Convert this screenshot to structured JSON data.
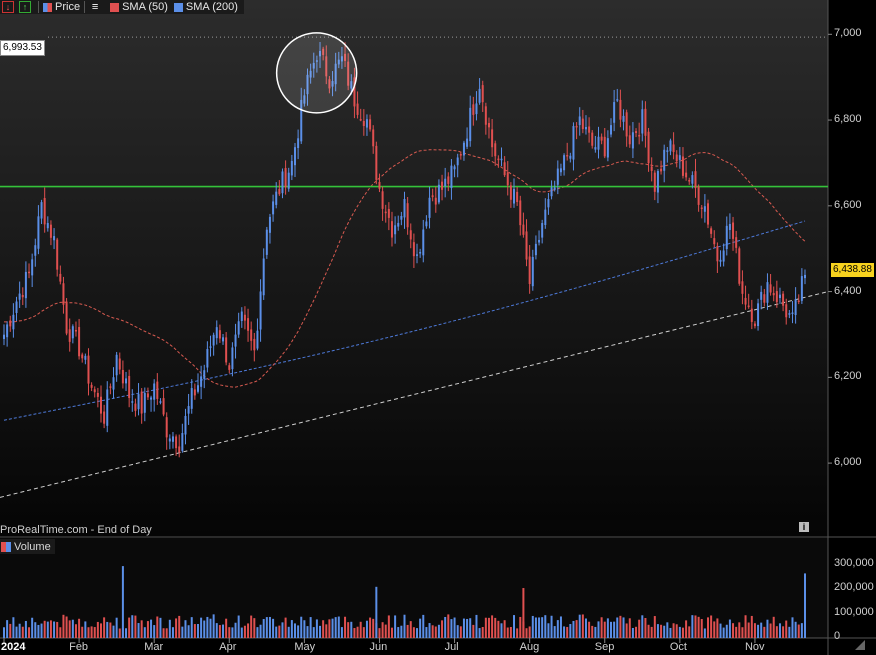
{
  "legend": {
    "price_label": "Price",
    "sma50_label": "SMA (50)",
    "sma200_label": "SMA (200)",
    "volume_label": "Volume"
  },
  "source_text": "ProRealTime.com - End of Day",
  "tags": {
    "period_high": "6,993.53",
    "last_price": "6,438.88"
  },
  "colors": {
    "up": "#5b8fe8",
    "down": "#e05050",
    "sma50": "#d85a50",
    "sma200": "#4d79d8",
    "resistance": "#34c23a",
    "trend": "#cfcfcf"
  },
  "chart_data": {
    "type": "candlestick",
    "instrument_note": "Daily candles with SMA(50), SMA(200), volume panel",
    "x_ticks": [
      "2024",
      "Feb",
      "Mar",
      "Apr",
      "May",
      "Jun",
      "Jul",
      "Aug",
      "Sep",
      "Oct",
      "Nov"
    ],
    "y_ticks": [
      "6,000",
      "6,200",
      "6,400",
      "6,600",
      "6,800",
      "7,000"
    ],
    "ylim": [
      5830,
      7080
    ],
    "volume_ticks": [
      "0",
      "100,000",
      "200,000",
      "300,000"
    ],
    "volume_lim": [
      0,
      320000
    ],
    "period_high": 6993.53,
    "last_close": 6438.88,
    "resistance_level": 6645,
    "trendline": {
      "start_value": 5920,
      "end_value": 6400
    },
    "anchors": [
      {
        "label": "2024",
        "close": 6300
      },
      {
        "label": "",
        "close": 6380
      },
      {
        "label": "",
        "close": 6440
      },
      {
        "label": "",
        "close": 6600
      },
      {
        "label": "",
        "close": 6520
      },
      {
        "label": "",
        "close": 6320
      },
      {
        "label": "Feb",
        "close": 6270
      },
      {
        "label": "",
        "close": 6180
      },
      {
        "label": "",
        "close": 6110
      },
      {
        "label": "",
        "close": 6250
      },
      {
        "label": "",
        "close": 6160
      },
      {
        "label": "",
        "close": 6130
      },
      {
        "label": "Mar",
        "close": 6180
      },
      {
        "label": "",
        "close": 6080
      },
      {
        "label": "",
        "close": 6050
      },
      {
        "label": "",
        "close": 6150
      },
      {
        "label": "",
        "close": 6220
      },
      {
        "label": "",
        "close": 6330
      },
      {
        "label": "Apr",
        "close": 6230
      },
      {
        "label": "",
        "close": 6330
      },
      {
        "label": "",
        "close": 6260
      },
      {
        "label": "",
        "close": 6560
      },
      {
        "label": "",
        "close": 6640
      },
      {
        "label": "",
        "close": 6700
      },
      {
        "label": "May",
        "close": 6860
      },
      {
        "label": "",
        "close": 6960
      },
      {
        "label": "",
        "close": 6900
      },
      {
        "label": "",
        "close": 6940
      },
      {
        "label": "",
        "close": 6850
      },
      {
        "label": "",
        "close": 6800
      },
      {
        "label": "Jun",
        "close": 6640
      },
      {
        "label": "",
        "close": 6550
      },
      {
        "label": "",
        "close": 6600
      },
      {
        "label": "",
        "close": 6480
      },
      {
        "label": "",
        "close": 6620
      },
      {
        "label": "",
        "close": 6640
      },
      {
        "label": "Jul",
        "close": 6680
      },
      {
        "label": "",
        "close": 6780
      },
      {
        "label": "",
        "close": 6890
      },
      {
        "label": "",
        "close": 6740
      },
      {
        "label": "",
        "close": 6670
      },
      {
        "label": "",
        "close": 6600
      },
      {
        "label": "Aug",
        "close": 6420
      },
      {
        "label": "",
        "close": 6560
      },
      {
        "label": "",
        "close": 6640
      },
      {
        "label": "",
        "close": 6720
      },
      {
        "label": "",
        "close": 6800
      },
      {
        "label": "",
        "close": 6740
      },
      {
        "label": "Sep",
        "close": 6740
      },
      {
        "label": "",
        "close": 6840
      },
      {
        "label": "",
        "close": 6760
      },
      {
        "label": "",
        "close": 6800
      },
      {
        "label": "",
        "close": 6650
      },
      {
        "label": "",
        "close": 6740
      },
      {
        "label": "Oct",
        "close": 6700
      },
      {
        "label": "",
        "close": 6650
      },
      {
        "label": "",
        "close": 6600
      },
      {
        "label": "",
        "close": 6480
      },
      {
        "label": "",
        "close": 6560
      },
      {
        "label": "",
        "close": 6400
      },
      {
        "label": "Nov",
        "close": 6340
      },
      {
        "label": "",
        "close": 6420
      },
      {
        "label": "",
        "close": 6380
      },
      {
        "label": "",
        "close": 6330
      },
      {
        "label": "",
        "close": 6438.88
      }
    ],
    "volume_highlights": {
      "Mar": 295000,
      "Jun": 210000,
      "Aug": 205000,
      "last": 265000
    },
    "volume_typical": 65000
  }
}
